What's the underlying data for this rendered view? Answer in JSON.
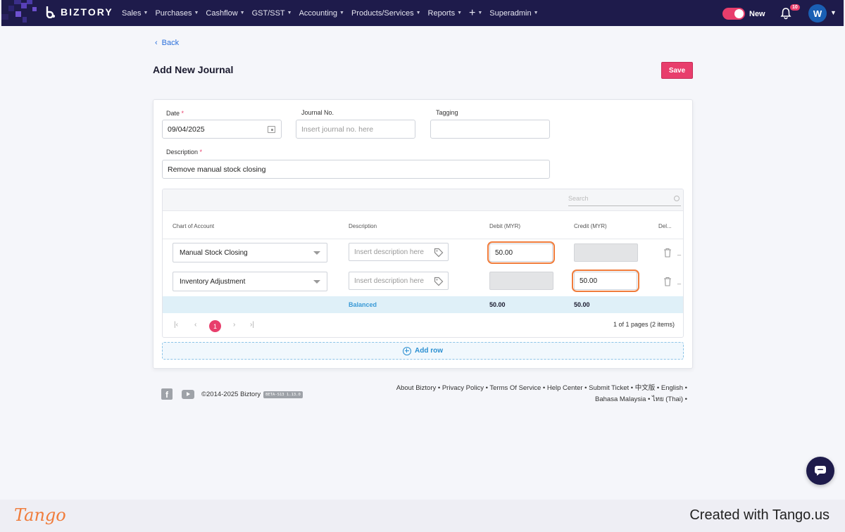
{
  "brand": {
    "name": "BIZTORY"
  },
  "nav": {
    "items": [
      "Sales",
      "Purchases",
      "Cashflow",
      "GST/SST",
      "Accounting",
      "Products/Services",
      "Reports"
    ],
    "plus": "+",
    "superadmin": "Superadmin",
    "toggle_label": "New",
    "notification_count": "10",
    "avatar_initial": "W"
  },
  "page": {
    "back_label": "Back",
    "title": "Add New Journal",
    "save_label": "Save"
  },
  "form": {
    "date_label": "Date",
    "date_value": "09/04/2025",
    "journal_no_label": "Journal No.",
    "journal_no_placeholder": "Insert journal no. here",
    "tagging_label": "Tagging",
    "description_label": "Description",
    "description_value": "Remove manual stock closing"
  },
  "table": {
    "search_placeholder": "Search",
    "headers": [
      "Chart of Account",
      "Description",
      "Debit (MYR)",
      "Credit (MYR)",
      "Del..."
    ],
    "rows": [
      {
        "account": "Manual Stock Closing",
        "description_placeholder": "Insert description here",
        "debit": "50.00",
        "credit": ""
      },
      {
        "account": "Inventory Adjustment",
        "description_placeholder": "Insert description here",
        "debit": "",
        "credit": "50.00"
      }
    ],
    "total": {
      "status": "Balanced",
      "debit": "50.00",
      "credit": "50.00"
    },
    "pager": {
      "current": "1",
      "info": "1 of 1 pages (2 items)"
    },
    "add_row": "Add row"
  },
  "footer": {
    "copyright": "©2014-2025 Biztory",
    "beta": "BETA-S13 1.13.0",
    "links_line1": "About Biztory • Privacy Policy • Terms Of Service • Help Center • Submit Ticket • 中文版 • English •",
    "links_line2": "Bahasa Malaysia • ไทย (Thai) •"
  },
  "tango": {
    "logo": "Tango",
    "created": "Created with Tango.us"
  },
  "colors": {
    "nav": "#1e1b4b",
    "accent": "#e83e6c",
    "highlight": "#f07c3b",
    "link": "#2a8fd1"
  }
}
